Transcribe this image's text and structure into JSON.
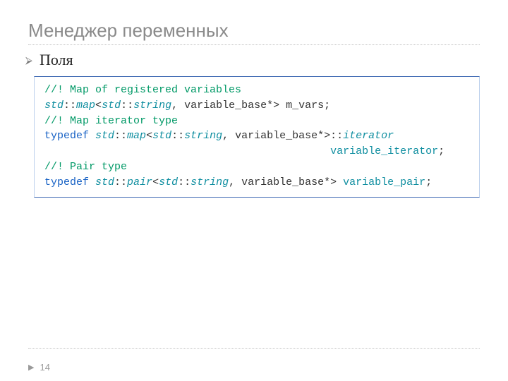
{
  "title": "Менеджер переменных",
  "bullet": "Поля",
  "code": {
    "l1_comment": "//! Map of registered variables",
    "l2_ns1": "std",
    "l2_sep1": "::",
    "l2_map": "map",
    "l2_lt": "<",
    "l2_ns2": "std",
    "l2_sep2": "::",
    "l2_string": "string",
    "l2_mid": ", variable_base*> m_vars;",
    "l3_comment": "//! Map iterator type",
    "l4_kw": "typedef ",
    "l4_ns1": "std",
    "l4_sep1": "::",
    "l4_map": "map",
    "l4_lt": "<",
    "l4_ns2": "std",
    "l4_sep2": "::",
    "l4_string": "string",
    "l4_mid": ", variable_base*>::",
    "l4_iter": "iterator",
    "l5_pad": "                                             ",
    "l5_decl": "variable_iterator",
    "l5_semi": ";",
    "l6_comment": "//! Pair type",
    "l7_kw": "typedef ",
    "l7_ns1": "std",
    "l7_sep1": "::",
    "l7_pair": "pair",
    "l7_lt": "<",
    "l7_ns2": "std",
    "l7_sep2": "::",
    "l7_string": "string",
    "l7_mid": ", variable_base*> ",
    "l7_decl": "variable_pair",
    "l7_semi": ";"
  },
  "footer": {
    "page": "14",
    "mark": "▶"
  }
}
